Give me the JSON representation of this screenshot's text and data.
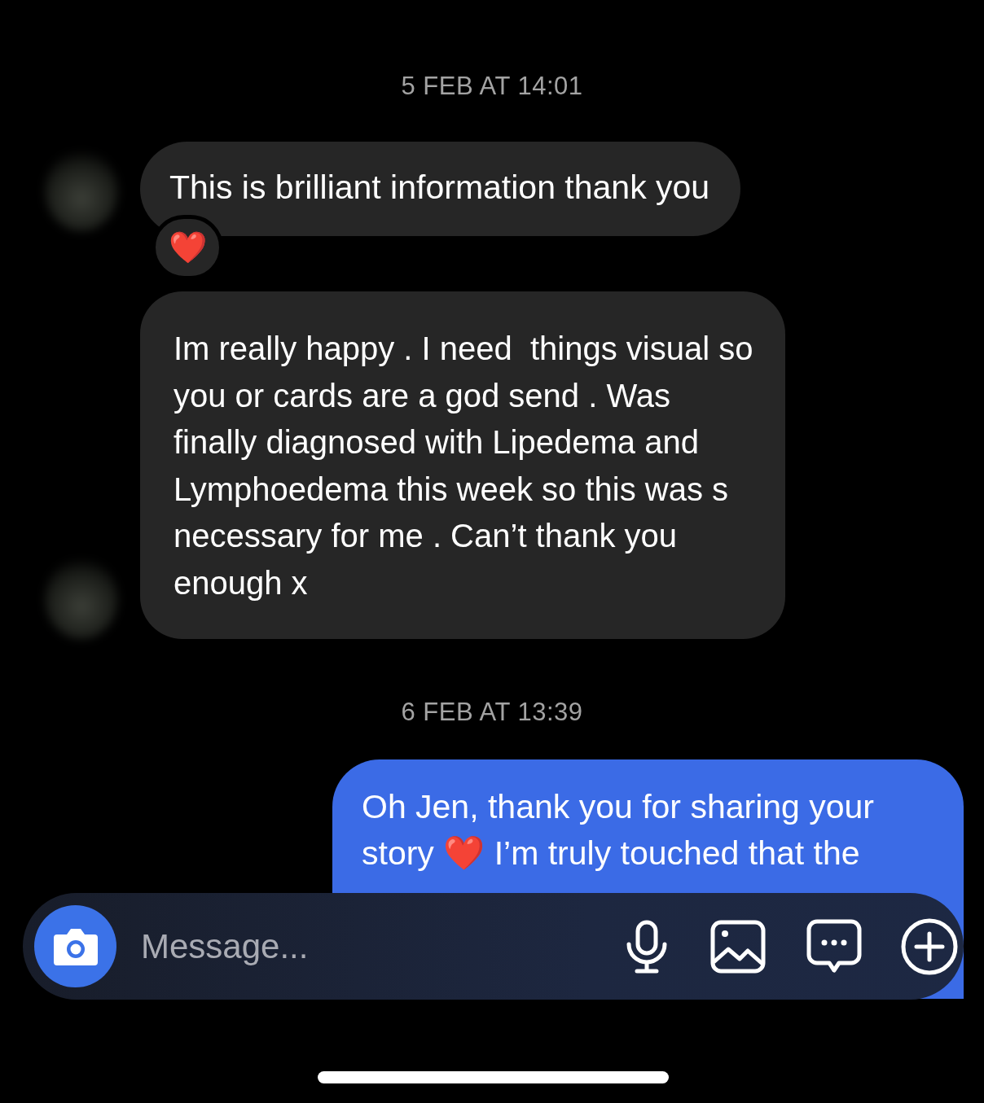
{
  "messages": [
    {
      "kind": "timestamp",
      "text": "5 FEB AT 14:01"
    },
    {
      "kind": "received",
      "avatar": true,
      "reaction": "❤️",
      "lines": [
        "This is brilliant information thank you"
      ]
    },
    {
      "kind": "received",
      "avatar": true,
      "lines": [
        "Im really happy . I need  things visual so",
        "you or cards are a god send . Was",
        "finally diagnosed with Lipedema and",
        "Lymphoedema this week so this was s",
        "necessary for me . Can’t thank you",
        "enough x"
      ]
    },
    {
      "kind": "timestamp",
      "text": "6 FEB AT 13:39"
    },
    {
      "kind": "sent",
      "lines": [
        "Oh Jen, thank you for sharing your",
        "story ❤️ I’m truly touched that the"
      ]
    }
  ],
  "composer": {
    "placeholder": "Message..."
  }
}
